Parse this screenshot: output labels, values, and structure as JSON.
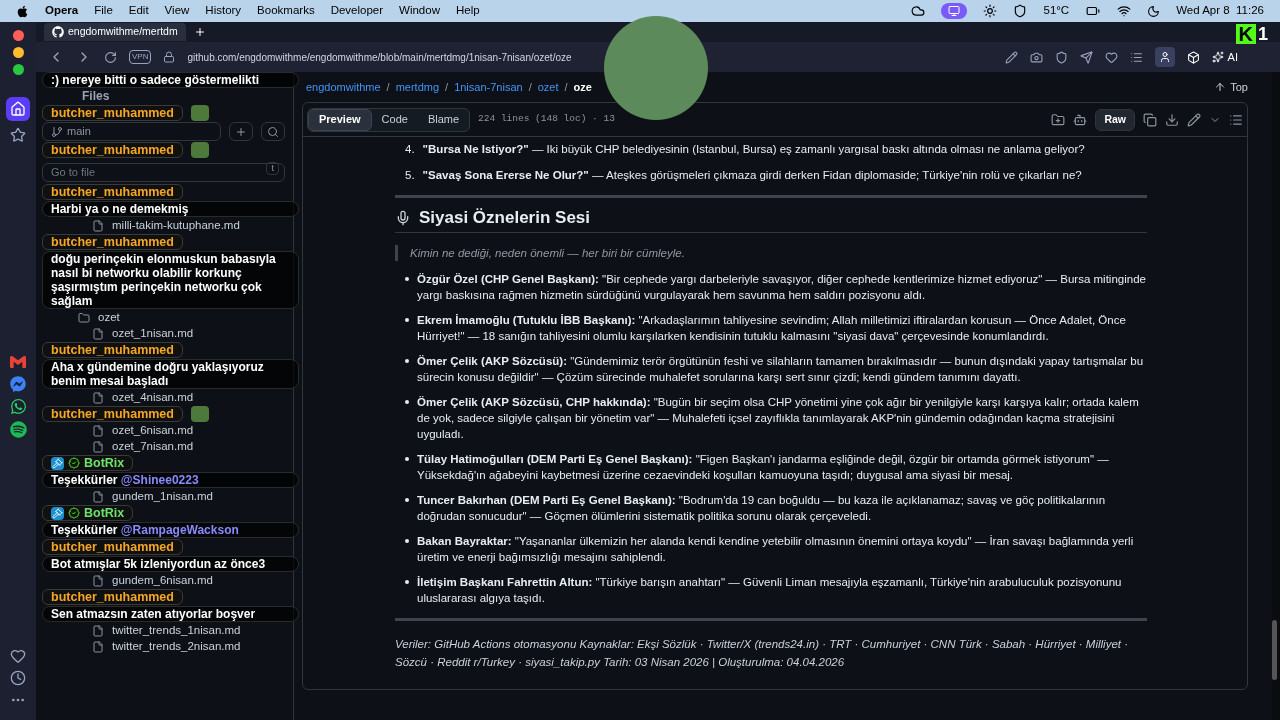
{
  "menubar": {
    "app": "Opera",
    "menus": [
      "File",
      "Edit",
      "View",
      "History",
      "Bookmarks",
      "Developer",
      "Window",
      "Help"
    ],
    "temperature": "51°C",
    "clock": "Wed Apr 8  11:26"
  },
  "stream_logo": {
    "letter": "K",
    "number": "1"
  },
  "tab": {
    "title": "engdomwithme/mertdm"
  },
  "address": {
    "vpn": "VPN",
    "url": "github.com/engdomwithme/engdomwithme/blob/main/mertdmg/1nisan-7nisan/ozet/oze",
    "ai": "AI"
  },
  "feed": [
    {
      "kind": "chat",
      "text": ":) nereye bitti o sadece göstermelikti"
    },
    {
      "kind": "files_title",
      "text": "Files"
    },
    {
      "kind": "emote_chat",
      "user": "butcher_muhammed",
      "bot": false
    },
    {
      "kind": "branch",
      "text": "main"
    },
    {
      "kind": "emote_chat",
      "user": "butcher_muhammed",
      "bot": false
    },
    {
      "kind": "go_to_file",
      "placeholder": "Go to file",
      "shortcut": "t"
    },
    {
      "kind": "chat",
      "user": "butcher_muhammed",
      "bot": false,
      "text": "Harbi ya o ne demekmiş"
    },
    {
      "kind": "file",
      "name": "milli-takim-kutuphane.md"
    },
    {
      "kind": "chat",
      "user": "butcher_muhammed",
      "bot": false,
      "text": "doğu perinçekin elonmuskun babasıyla nasıl bi networku olabilir korkunç şaşırmıştım perinçekin networku çok sağlam"
    },
    {
      "kind": "folder",
      "name": "ozet"
    },
    {
      "kind": "file",
      "name": "ozet_1nisan.md"
    },
    {
      "kind": "chat",
      "user": "butcher_muhammed",
      "bot": false,
      "text": "Aha x gündemine doğru yaklaşıyoruz benim mesai başladı"
    },
    {
      "kind": "file",
      "name": "ozet_4nisan.md"
    },
    {
      "kind": "emote_chat",
      "user": "butcher_muhammed",
      "bot": false
    },
    {
      "kind": "file",
      "name": "ozet_6nisan.md"
    },
    {
      "kind": "file",
      "name": "ozet_7nisan.md"
    },
    {
      "kind": "chat",
      "user": "BotRix",
      "bot": true,
      "text": "Teşekkürler",
      "mention": "@Shinee0223"
    },
    {
      "kind": "file",
      "name": "gundem_1nisan.md"
    },
    {
      "kind": "chat",
      "user": "BotRix",
      "bot": true,
      "text": "Teşekkürler",
      "mention": "@RampageWackson"
    },
    {
      "kind": "chat",
      "user": "butcher_muhammed",
      "bot": false,
      "text": "Bot atmışlar 5k izleniyordun az önce3"
    },
    {
      "kind": "file",
      "name": "gundem_6nisan.md"
    },
    {
      "kind": "chat",
      "user": "butcher_muhammed",
      "bot": false,
      "text": "Sen atmazsın zaten atıyorlar boşver"
    },
    {
      "kind": "file",
      "name": "twitter_trends_1nisan.md"
    },
    {
      "kind": "file",
      "name": "twitter_trends_2nisan.md"
    }
  ],
  "breadcrumb": [
    {
      "kind": "link",
      "text": "engdomwithme"
    },
    {
      "kind": "separator",
      "text": "/"
    },
    {
      "kind": "link",
      "text": "mertdmg"
    },
    {
      "kind": "separator",
      "text": "/"
    },
    {
      "kind": "link",
      "text": "1nisan-7nisan"
    },
    {
      "kind": "separator",
      "text": "/"
    },
    {
      "kind": "link",
      "text": "ozet"
    },
    {
      "kind": "separator",
      "text": "/"
    },
    {
      "kind": "current",
      "text": "oze"
    }
  ],
  "top_link": "Top",
  "view_tabs": [
    {
      "label": "Preview",
      "selected": true
    },
    {
      "label": "Code",
      "selected": false
    },
    {
      "label": "Blame",
      "selected": false
    }
  ],
  "file_info": "224 lines (148 loc) · 13",
  "raw_button": "Raw",
  "numbered": [
    {
      "number": "4.",
      "text": "**\"Bursa Ne Istiyor?\"** — Iki büyük CHP belediyesinin (Istanbul, Bursa) eş zamanlı yargısal baskı altında olması ne anlama geliyor?"
    },
    {
      "number": "5.",
      "text": "**\"Savaş Sona Ererse Ne Olur?\"** — Ateşkes görüşmeleri çıkmaza girdi derken Fidan diplomaside; Türkiye'nin rolü ve çıkarları ne?"
    }
  ],
  "section_title": "Siyasi Öznelerin Sesi",
  "quote": "Kimin ne dediği, neden önemli — her biri bir cümleyle.",
  "bullets": [
    "**Özgür Özel (CHP Genel Başkanı):** \"Bir cephede yargı darbeleriyle savaşıyor, diğer cephede kentlerimize hizmet ediyoruz\" — Bursa mitinginde yargı baskısına rağmen hizmetin sürdüğünü vurgulayarak hem savunma hem saldırı pozisyonu aldı.",
    "**Ekrem İmamoğlu (Tutuklu İBB Başkanı):** \"Arkadaşlarımın tahliyesine sevindim; Allah milletimizi iftiralardan korusun — Önce Adalet, Önce Hürriyet!\" — 18 sanığın tahliyesini olumlu karşılarken kendisinin tutuklu kalmasını \"siyasi dava\" çerçevesinde konumlandırdı.",
    "**Ömer Çelik (AKP Sözcüsü):** \"Gündemimiz terör örgütünün feshi ve silahların tamamen bırakılmasıdır — bunun dışındaki yapay tartışmalar bu sürecin konusu değildir\" — Çözüm sürecinde muhalefet sorularına karşı sert sınır çizdi; kendi gündem tanımını dayattı.",
    "**Ömer Çelik (AKP Sözcüsü, CHP hakkında):** \"Bugün bir seçim olsa CHP yönetimi yine çok ağır bir yenilgiyle karşı karşıya kalır; ortada kalem de yok, sadece silgiyle çalışan bir yönetim var\" — Muhalefeti içsel zayıflıkla tanımlayarak AKP'nin gündemin odağından kaçma stratejisini uyguladı.",
    "**Tülay Hatimoğulları (DEM Parti Eş Genel Başkanı):** \"Figen Başkan'ı jandarma eşliğinde değil, özgür bir ortamda görmek istiyorum\" — Yüksekdağ'ın ağabeyini kaybetmesi üzerine cezaevindeki koşulları kamuoyuna taşıdı; duygusal ama siyasi bir mesaj.",
    "**Tuncer Bakırhan (DEM Parti Eş Genel Başkanı):** \"Bodrum'da 19 can boğuldu — bu kaza ile açıklanamaz; savaş ve göç politikalarının doğrudan sonucudur\" — Göçmen ölümlerini sistematik politika sorunu olarak çerçeveledi.",
    "**Bakan Bayraktar:** \"Yaşananlar ülkemizin her alanda kendi kendine yetebilir olmasının önemini ortaya koydu\" — İran savaşı bağlamında yerli üretim ve enerji bağımsızlığı mesajını sahiplendi.",
    "**İletişim Başkanı Fahrettin Altun:** \"Türkiye barışın anahtarı\" — Güvenli Liman mesajıyla eşzamanlı, Türkiye'nin arabuluculuk pozisyonunu uluslararası algıya taşıdı."
  ],
  "footer": "Veriler: GitHub Actions otomasyonu Kaynaklar: Ekşi Sözlük · Twitter/X (trends24.in) · TRT · Cumhuriyet · CNN Türk · Sabah · Hürriyet · Milliyet · Sözcü · Reddit r/Turkey · siyasi_takip.py Tarih: 03 Nisan 2026 | Oluşturulma: 04.04.2026"
}
